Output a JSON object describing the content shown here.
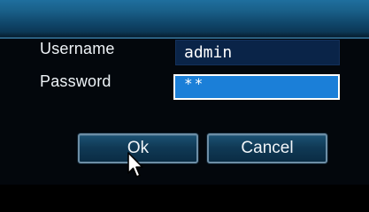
{
  "login_form": {
    "username_label": "Username",
    "username_value": "admin",
    "password_label": "Password",
    "password_value": "**"
  },
  "buttons": {
    "ok_label": "Ok",
    "cancel_label": "Cancel"
  },
  "colors": {
    "title_bar": "#195f88",
    "background": "#03070c",
    "username_field_bg": "#0a2448",
    "password_field_bg": "#1b7fd8",
    "button_bg": "#103a56",
    "button_border": "#6d8ea6"
  },
  "icons": {
    "cursor": "mouse-pointer-icon"
  }
}
